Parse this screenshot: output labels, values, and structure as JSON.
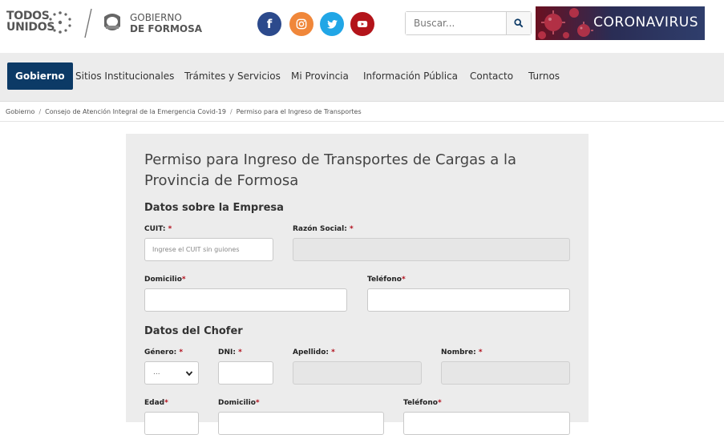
{
  "header": {
    "logo_left_line1": "TODOS",
    "logo_left_line2": "UNIDOS",
    "logo_right_line1": "GOBIERNO",
    "logo_right_line2": "DE FORMOSA",
    "social": [
      {
        "name": "facebook",
        "glyph": "f"
      },
      {
        "name": "instagram",
        "glyph": "◎"
      },
      {
        "name": "twitter",
        "glyph": "t"
      },
      {
        "name": "youtube",
        "glyph": "▶"
      }
    ],
    "search_placeholder": "Buscar...",
    "banner_text": "CORONAVIRUS"
  },
  "nav": {
    "items": [
      {
        "label": "Gobierno",
        "active": true
      },
      {
        "label": "Sitios Institucionales"
      },
      {
        "label": "Trámites y Servicios"
      },
      {
        "label": "Mi Provincia"
      },
      {
        "label": "Información Pública"
      },
      {
        "label": "Contacto"
      },
      {
        "label": "Turnos"
      }
    ]
  },
  "breadcrumb": {
    "items": [
      "Gobierno",
      "Consejo de Atención Integral de la Emergencia Covid-19",
      "Permiso para el Ingreso de Transportes"
    ],
    "separator": "/"
  },
  "form": {
    "title": "Permiso para Ingreso de Transportes de Cargas a la Provincia de Formosa",
    "section_empresa": "Datos sobre la Empresa",
    "cuit_label": "CUIT: ",
    "cuit_placeholder": "Ingrese el CUIT sin guiones",
    "razon_label": "Razón Social: ",
    "domicilio_label": "Domicilio",
    "telefono_label": "Teléfono",
    "section_chofer": "Datos del Chofer",
    "genero_label": "Género: ",
    "genero_value": "...",
    "dni_label": "DNI: ",
    "apellido_label": "Apellido: ",
    "nombre_label": "Nombre: ",
    "edad_label": "Edad",
    "domicilio2_label": "Domicilio",
    "telefono2_label": "Teléfono",
    "required_mark": "*"
  },
  "colors": {
    "nav_active": "#0c3a66",
    "required": "#b10d1a",
    "facebook": "#2c4a8c",
    "instagram": "#f0873a",
    "twitter": "#21a6e6",
    "youtube": "#b3141a"
  }
}
